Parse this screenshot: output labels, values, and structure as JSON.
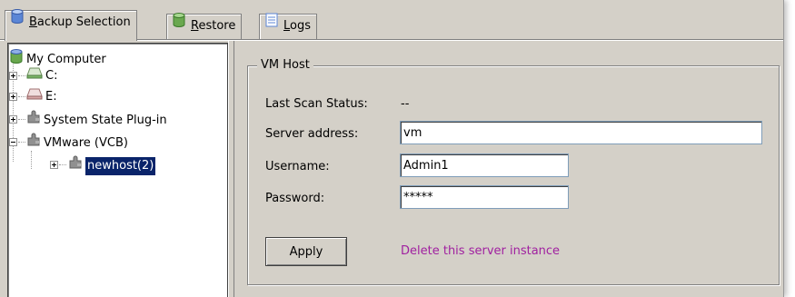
{
  "tabs": [
    {
      "prefix": "",
      "underline": "B",
      "rest": "ackup Selection",
      "icon": "database-icon",
      "active": true
    },
    {
      "prefix": "",
      "underline": "R",
      "rest": "estore",
      "icon": "database-icon",
      "active": false
    },
    {
      "prefix": "",
      "underline": "L",
      "rest": "ogs",
      "icon": "log-file-icon",
      "active": false
    }
  ],
  "tree": {
    "root": "My Computer",
    "items": [
      {
        "label": "C:",
        "icon": "drive-icon"
      },
      {
        "label": "E:",
        "icon": "drive-icon"
      },
      {
        "label": "System State Plug-in",
        "icon": "plugin-icon"
      },
      {
        "label": "VMware (VCB)",
        "icon": "plugin-icon"
      },
      {
        "label": "newhost(2)",
        "icon": "plugin-icon"
      }
    ]
  },
  "vmhost": {
    "title": "VM Host",
    "last_scan_label": "Last Scan Status:",
    "last_scan_value": "--",
    "server_label": "Server address:",
    "server_value": "vm",
    "username_label": "Username:",
    "username_value": "Admin1",
    "password_label": "Password:",
    "password_value": "*****",
    "apply_label": "Apply",
    "delete_link": "Delete this server instance"
  },
  "colors": {
    "selection": "#0a246a",
    "link": "#a020a0",
    "chrome": "#d4d0c8"
  }
}
